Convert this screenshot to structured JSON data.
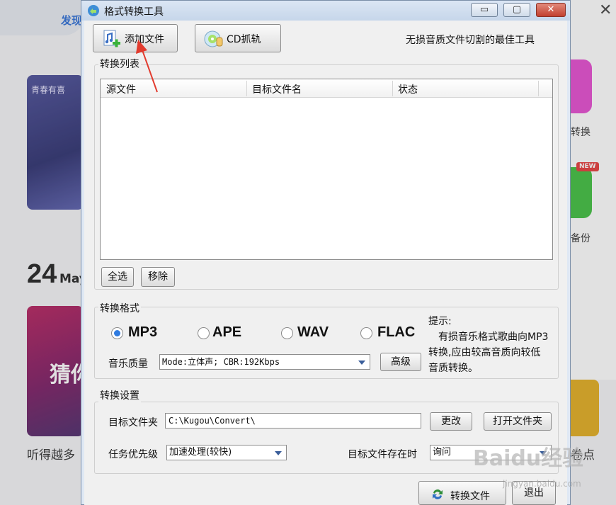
{
  "background": {
    "nav_tab": "发现",
    "card1_logo": "青春有喜",
    "date_day": "24",
    "date_month": "May",
    "card2_text": "猜你",
    "caption_left": "听得越多",
    "right_label_1": "转换",
    "new_badge": "NEW",
    "right_label_2": "备份",
    "caption_right": "卷点",
    "watermark": "Baidu经验",
    "watermark_sub": "jingyan.baidu.com"
  },
  "window": {
    "title": "格式转换工具",
    "min_glyph": "▭",
    "max_glyph": "▢",
    "close_glyph": "✕"
  },
  "toolbar": {
    "add_label": "添加文件",
    "cd_label": "CD抓轨",
    "slogan": "无损音质文件切割的最佳工具"
  },
  "convert_list": {
    "group_title": "转换列表",
    "columns": [
      "源文件",
      "目标文件名",
      "状态"
    ],
    "rows": [],
    "select_all": "全选",
    "remove": "移除"
  },
  "format": {
    "group_title": "转换格式",
    "options": [
      {
        "label": "MP3",
        "selected": true
      },
      {
        "label": "APE",
        "selected": false
      },
      {
        "label": "WAV",
        "selected": false
      },
      {
        "label": "FLAC",
        "selected": false
      }
    ],
    "quality_label": "音乐质量",
    "quality_value": "Mode:立体声; CBR:192Kbps",
    "advanced": "高级",
    "hint_title": "提示:",
    "hint_lines": [
      "有损音乐格式歌曲向MP3",
      "转换,应由较高音质向较低",
      "音质转换。"
    ]
  },
  "settings": {
    "group_title": "转换设置",
    "target_folder_label": "目标文件夹",
    "target_folder_value": "C:\\Kugou\\Convert\\",
    "change": "更改",
    "open_folder": "打开文件夹",
    "priority_label": "任务优先级",
    "priority_value": "加速处理(较快)",
    "exists_label": "目标文件存在时",
    "exists_value": "询问"
  },
  "footer": {
    "convert": "转换文件",
    "exit": "退出"
  },
  "colors": {
    "accent_blue": "#2f7be0",
    "annotation_red": "#e23b2e"
  }
}
